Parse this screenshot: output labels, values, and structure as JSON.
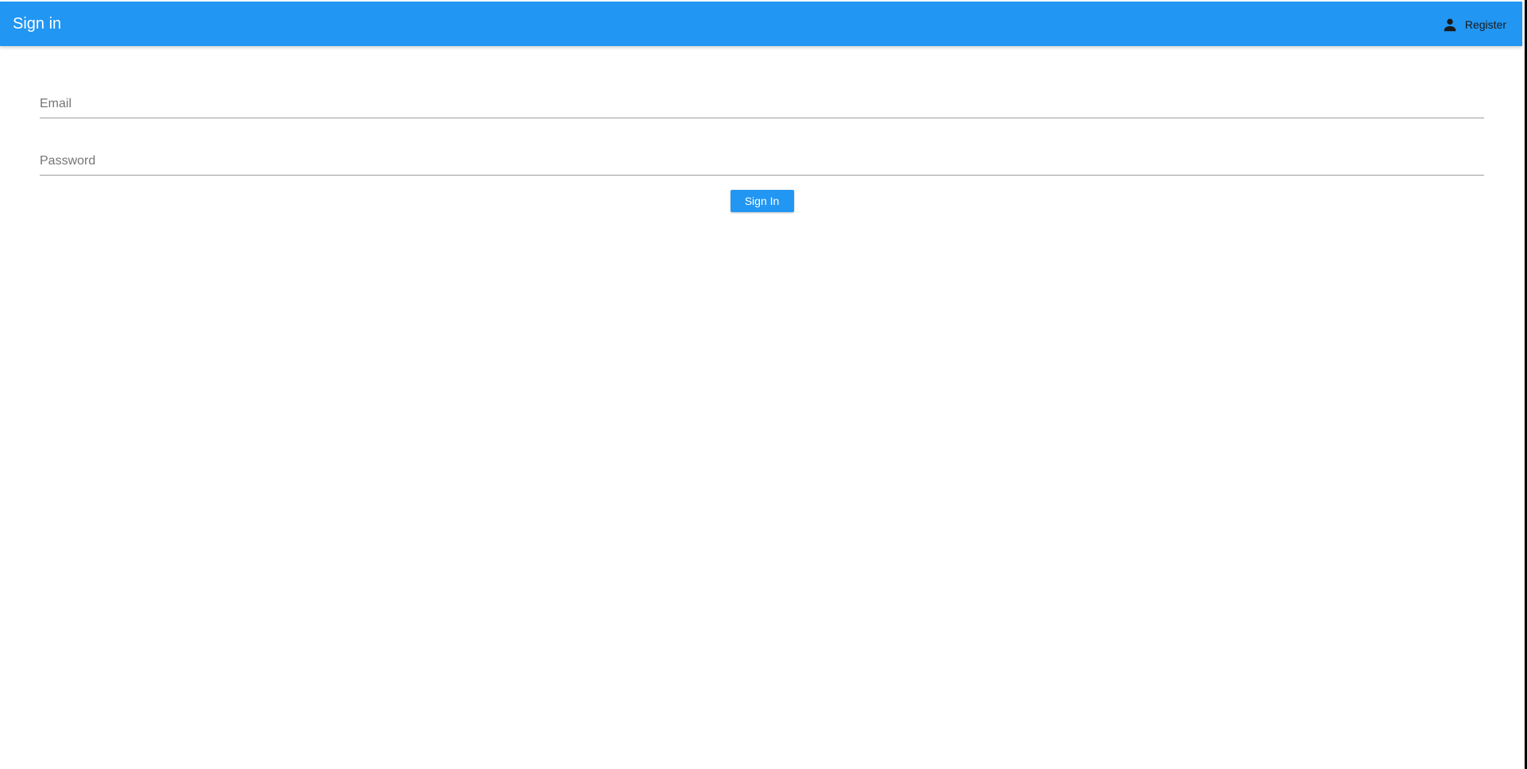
{
  "colors": {
    "primary": "#2196f3",
    "background": "#ffffff",
    "field_underline": "#9e9e9e",
    "placeholder": "#757575"
  },
  "header": {
    "title": "Sign in",
    "register_label": "Register",
    "register_icon": "person-icon"
  },
  "form": {
    "email": {
      "value": "",
      "placeholder": "Email"
    },
    "password": {
      "value": "",
      "placeholder": "Password"
    },
    "submit_label": "Sign In"
  }
}
